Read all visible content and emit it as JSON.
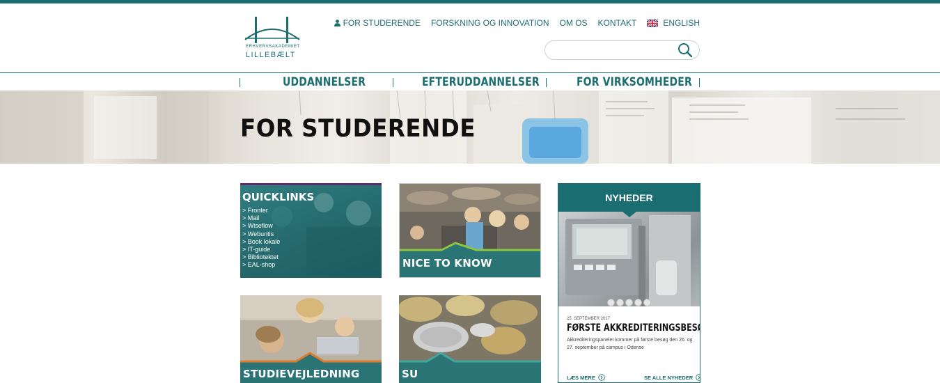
{
  "colors": {
    "brand": "#1a6e72",
    "accent_purple": "#5a2d6e",
    "accent_orange": "#e07b2a",
    "accent_lime": "#8cc63f"
  },
  "logo": {
    "line1": "ERHVERVSAKADEMIET",
    "line2": "LILLEBÆLT"
  },
  "topnav": {
    "items": [
      {
        "label": "FOR STUDERENDE",
        "icon": "user-icon"
      },
      {
        "label": "FORSKNING OG INNOVATION"
      },
      {
        "label": "OM OS"
      },
      {
        "label": "KONTAKT"
      },
      {
        "label": "ENGLISH",
        "icon": "uk-flag-icon"
      }
    ]
  },
  "search": {
    "placeholder": "",
    "value": "",
    "icon": "search-icon"
  },
  "mainnav": {
    "items": [
      {
        "label": "UDDANNELSER"
      },
      {
        "label": "EFTERUDDANNELSER"
      },
      {
        "label": "FOR VIRKSOMHEDER"
      }
    ]
  },
  "hero": {
    "title": "FOR STUDERENDE"
  },
  "quicklinks": {
    "title": "QUICKLINKS",
    "links": [
      "> Fronter",
      "> Mail",
      "> Wiseflow",
      "> Webuntis",
      "> Book lokale",
      "> IT-guide",
      "> Bibliotektet",
      "> EAL-shop"
    ]
  },
  "tiles": {
    "nice": "NICE TO KNOW",
    "vejl": "STUDIEVEJLEDNING",
    "su": "SU"
  },
  "news": {
    "heading": "NYHEDER",
    "slides": 5,
    "date": "25. SEPTEMBER 2017",
    "title": "FØRSTE AKKREDITERINGSBESØG",
    "text": "Akkrediteringspanelet kommer på første besøg den 26. og 27. september på campus i Odense",
    "read_more": "LÆS MERE",
    "see_all": "SE ALLE NYHEDER"
  }
}
